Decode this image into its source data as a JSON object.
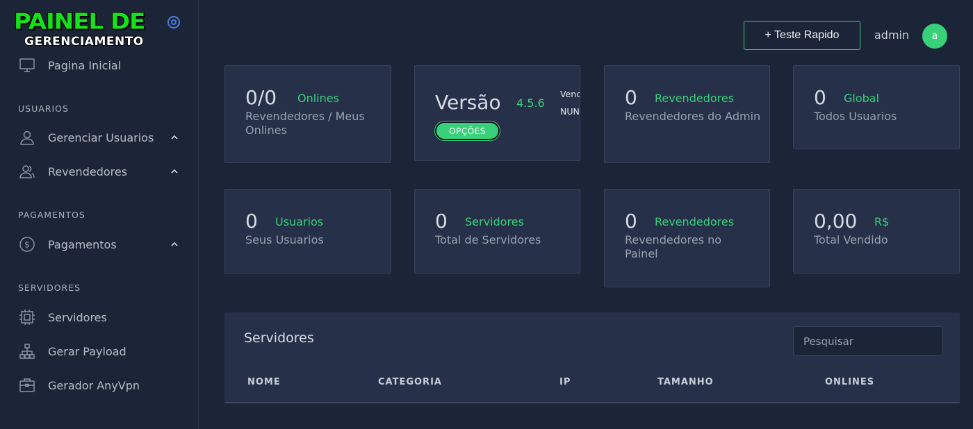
{
  "sidebar": {
    "logo_line1": "PAINEL DE",
    "logo_line2": "GERENCIAMENTO",
    "items": {
      "home": "Pagina Inicial",
      "gerenciar_usuarios": "Gerenciar Usuarios",
      "revendedores": "Revendedores",
      "pagamentos": "Pagamentos",
      "servidores": "Servidores",
      "gerar_payload": "Gerar Payload",
      "gerador_anyvpn": "Gerador AnyVpn"
    },
    "sections": {
      "usuarios": "USUARIOS",
      "pagamentos": "PAGAMENTOS",
      "servidores": "SERVIDORES"
    }
  },
  "header": {
    "teste_button": "+ Teste Rapido",
    "user_name": "admin",
    "avatar_letter": "a"
  },
  "cards": {
    "onlines": {
      "value": "0/0",
      "tag": "Onlines",
      "sub": "Revendedores / Meus Onlines"
    },
    "versao": {
      "title": "Versão",
      "version": "4.5.6",
      "button": "OPÇÕES",
      "venc_label": "Vencimento",
      "venc_value": "NUNCA"
    },
    "revendedores_admin": {
      "value": "0",
      "tag": "Revendedores",
      "sub": "Revendedores do Admin"
    },
    "global": {
      "value": "0",
      "tag": "Global",
      "sub": "Todos Usuarios"
    },
    "usuarios": {
      "value": "0",
      "tag": "Usuarios",
      "sub": "Seus Usuarios"
    },
    "servidores": {
      "value": "0",
      "tag": "Servidores",
      "sub": "Total de Servidores"
    },
    "revendedores_painel": {
      "value": "0",
      "tag": "Revendedores",
      "sub": "Revendedores no Painel"
    },
    "vendido": {
      "value": "0,00",
      "tag": "R$",
      "sub": "Total Vendido"
    }
  },
  "servers_panel": {
    "title": "Servidores",
    "search_placeholder": "Pesquisar",
    "columns": [
      "NOME",
      "CATEGORIA",
      "IP",
      "TAMANHO",
      "ONLINES"
    ]
  },
  "colors": {
    "accent_green": "#39d07a",
    "background": "#1c2537",
    "card": "#263048",
    "logo_green": "#16e21b",
    "icon_blue": "#4a7fe0"
  }
}
